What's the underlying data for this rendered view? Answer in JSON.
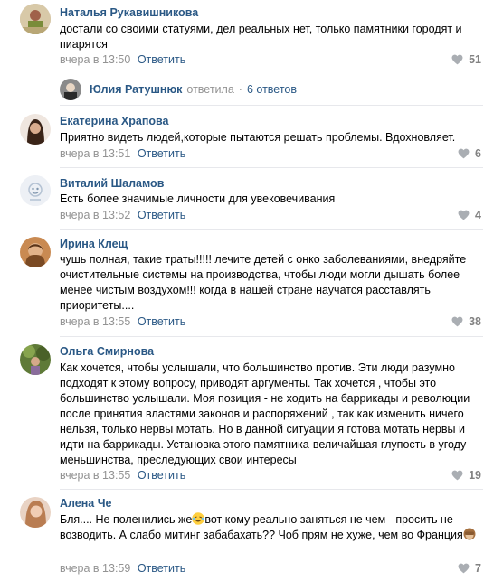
{
  "comments": [
    {
      "author": "Наталья Рукавишникова",
      "text": "достали со своими статуями, дел реальных нет, только памятники городят и пиарятся",
      "time": "вчера в 13:50",
      "reply": "Ответить",
      "likes": "51"
    },
    {
      "author": "Екатерина Храпова",
      "text": "Приятно видеть людей,которые пытаются решать проблемы. Вдохновляет.",
      "time": "вчера в 13:51",
      "reply": "Ответить",
      "likes": "6"
    },
    {
      "author": "Виталий Шаламов",
      "text": "Есть более значимые личности для увековечивания",
      "time": "вчера в 13:52",
      "reply": "Ответить",
      "likes": "4"
    },
    {
      "author": "Ирина Клещ",
      "text": "чушь полная, такие траты!!!!! лечите детей с онко заболеваниями, внедряйте очистительные системы на производства, чтобы люди могли дышать более менее чистым воздухом!!! когда в нашей стране научатся расставлять приоритеты....",
      "time": "вчера в 13:55",
      "reply": "Ответить",
      "likes": "38"
    },
    {
      "author": "Ольга Смирнова",
      "text": "Как хочется, чтобы услышали, что большинство против. Эти люди разумно подходят к этому вопросу, приводят аргументы. Так хочется , чтобы это большинство услышали. Моя позиция - не ходить на баррикады и революции после принятия властями законов и распоряжений , так как изменить ничего нельзя, только нервы мотать. Но в данной ситуации я готова мотать нервы и идти на баррикады. Установка этого памятника-величайшая глупость в угоду меньшинства, преследующих свои интересы",
      "time": "вчера в 13:55",
      "reply": "Ответить",
      "likes": "19"
    },
    {
      "author": "Алена Че",
      "text_a": "Бля.... Не поленились же",
      "text_b": "вот кому реально заняться не чем - просить не возводить. А слабо митинг забабахать?? Чоб прям не хуже, чем во Франция",
      "time": "вчера в 13:59",
      "reply": "Ответить",
      "likes": "7"
    }
  ],
  "thread": {
    "author": "Юлия Ратушнюк",
    "verb": "ответила",
    "dot": "·",
    "count": "6 ответов"
  },
  "colors": {
    "link": "#2a5885",
    "meta": "#939393",
    "divider": "#e7e8ec"
  }
}
